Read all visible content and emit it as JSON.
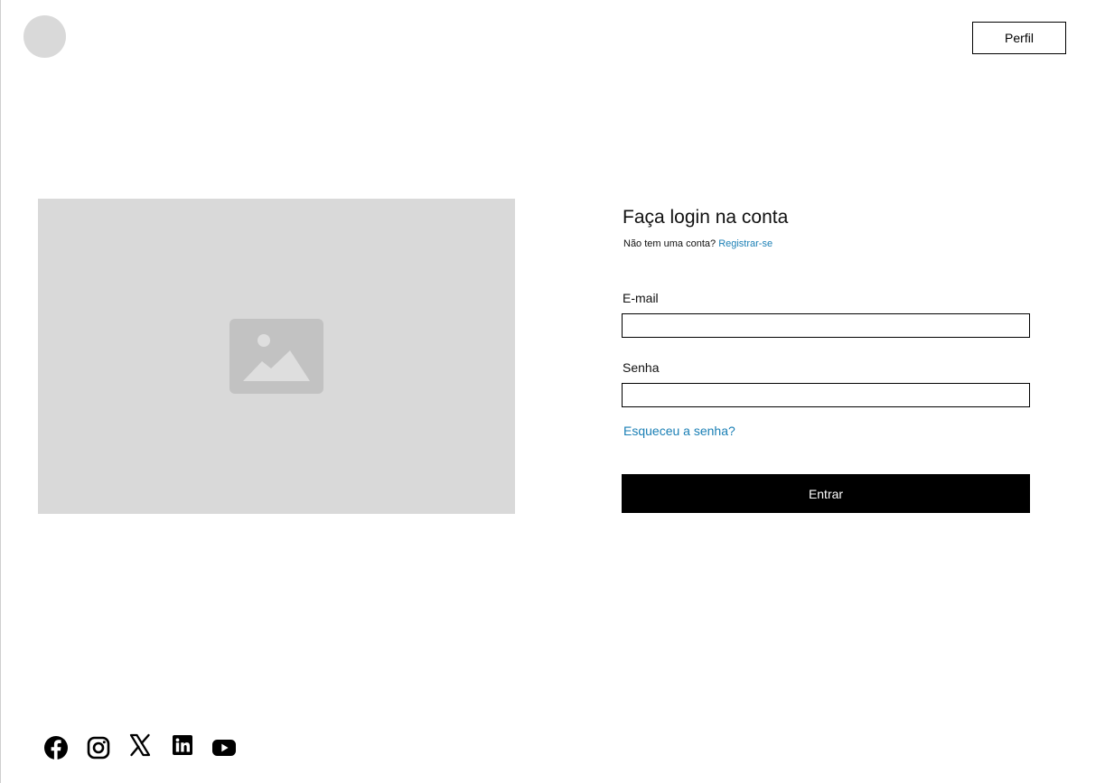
{
  "header": {
    "avatar_icon": "avatar-placeholder",
    "profile_button_label": "Perfil"
  },
  "hero": {
    "image_icon": "image-placeholder-icon"
  },
  "login": {
    "title": "Faça login na conta",
    "no_account_text": "Não tem uma conta?",
    "register_link": "Registrar-se",
    "email_label": "E-mail",
    "email_value": "",
    "password_label": "Senha",
    "password_value": "",
    "forgot_link": "Esqueceu a senha?",
    "submit_label": "Entrar"
  },
  "social": {
    "icons": [
      "facebook-icon",
      "instagram-icon",
      "x-icon",
      "linkedin-icon",
      "youtube-icon"
    ]
  },
  "colors": {
    "link": "#1a7fb5",
    "placeholder_gray": "#d9d9d9",
    "primary_button": "#000000",
    "primary_button_text": "#ffffff"
  }
}
